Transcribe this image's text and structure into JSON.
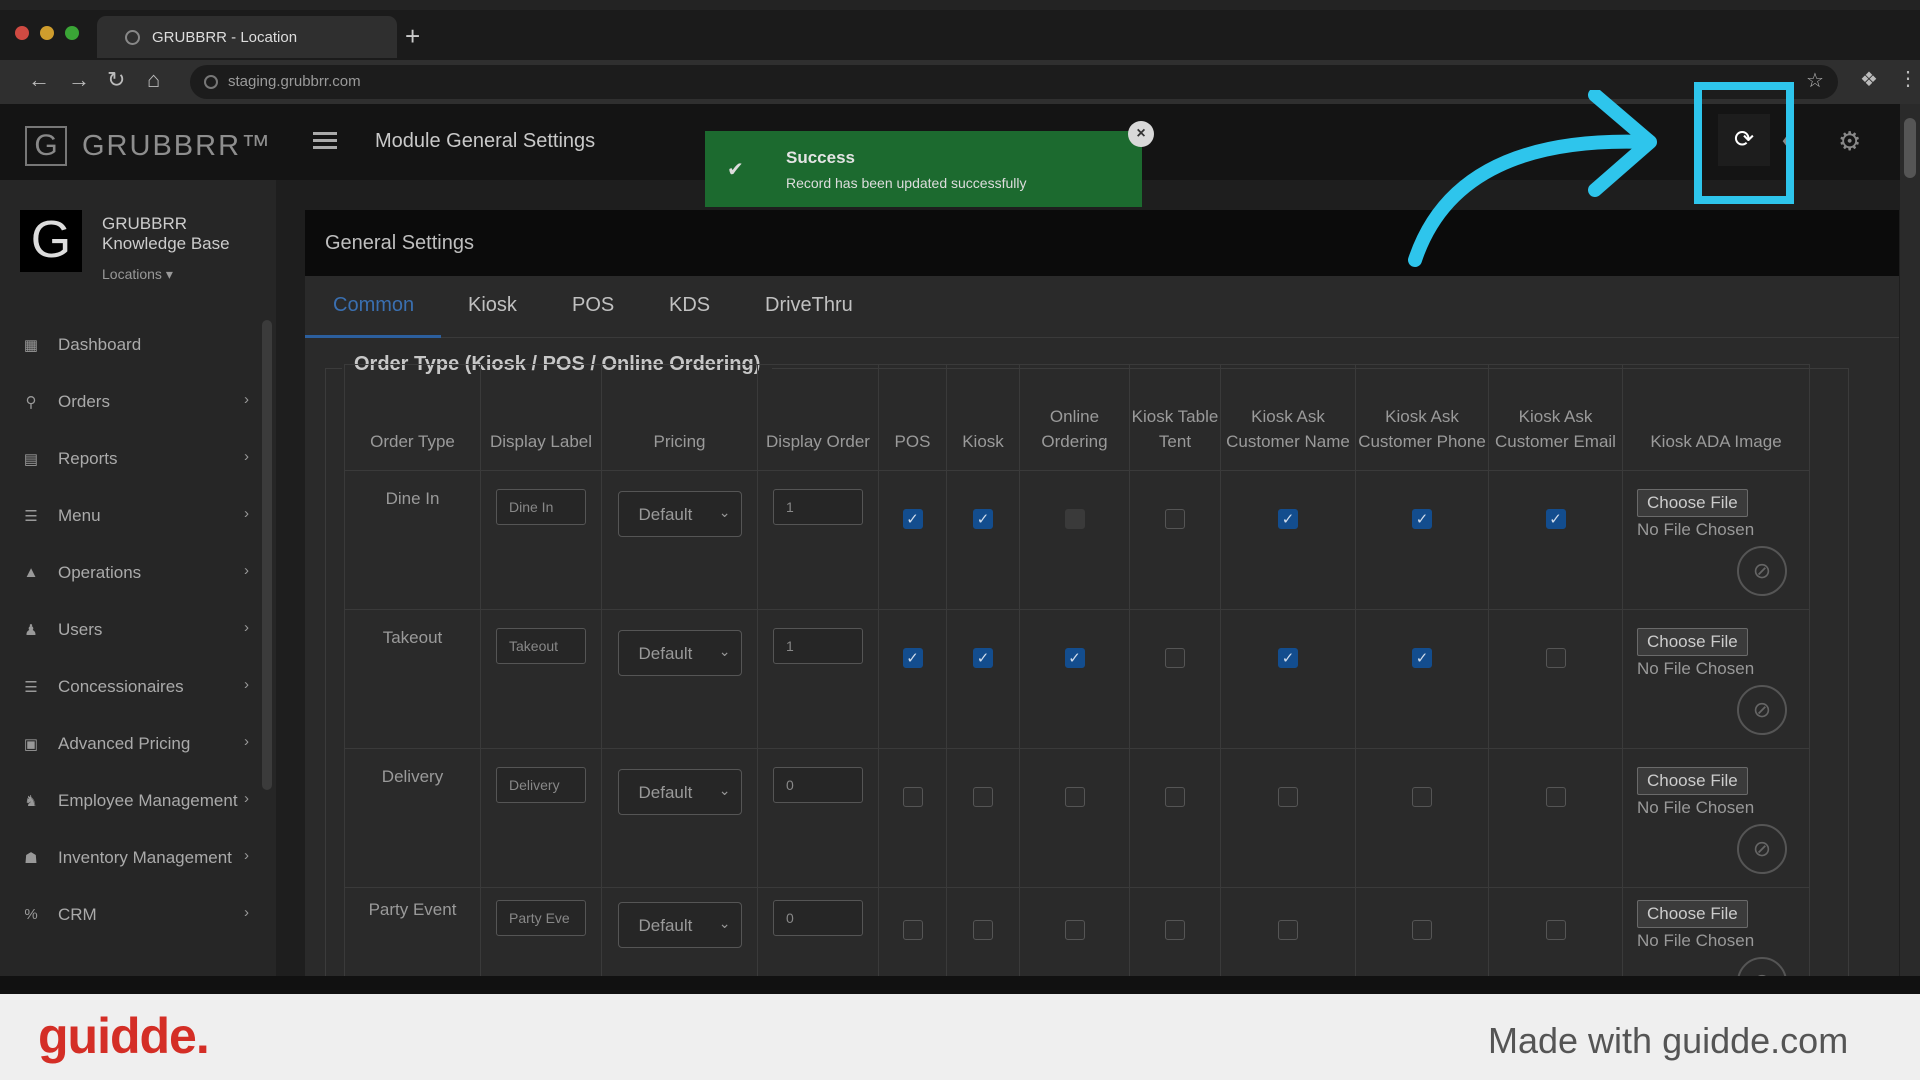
{
  "browser": {
    "tab_title": "GRUBBRR - Location",
    "url": "staging.grubbrr.com",
    "new_tab": "+"
  },
  "header": {
    "logo_letter": "G",
    "logo_text": "GRUBBRR™",
    "page_title": "Module General Settings"
  },
  "sidebar": {
    "avatar_letter": "G",
    "org_name": "GRUBBRR Knowledge Base",
    "locations_label": "Locations ▾",
    "items": [
      {
        "label": "Dashboard",
        "icon": "dashboard-icon",
        "chevron": ""
      },
      {
        "label": "Orders",
        "icon": "cart-icon",
        "chevron": "›"
      },
      {
        "label": "Reports",
        "icon": "report-icon",
        "chevron": "›"
      },
      {
        "label": "Menu",
        "icon": "menu-list-icon",
        "chevron": "›"
      },
      {
        "label": "Operations",
        "icon": "flask-icon",
        "chevron": "›"
      },
      {
        "label": "Users",
        "icon": "user-add-icon",
        "chevron": "›"
      },
      {
        "label": "Concessionaires",
        "icon": "list-icon",
        "chevron": "›"
      },
      {
        "label": "Advanced Pricing",
        "icon": "money-icon",
        "chevron": "›"
      },
      {
        "label": "Employee Management",
        "icon": "group-icon",
        "chevron": "›"
      },
      {
        "label": "Inventory Management",
        "icon": "sitemap-icon",
        "chevron": "›"
      },
      {
        "label": "CRM",
        "icon": "percent-icon",
        "chevron": "›"
      }
    ]
  },
  "toast": {
    "title": "Success",
    "message": "Record has been updated successfully"
  },
  "card": {
    "title": "General Settings",
    "tabs": [
      "Common",
      "Kiosk",
      "POS",
      "KDS",
      "DriveThru"
    ],
    "active_tab": "Common",
    "legend": "Order Type (Kiosk / POS / Online Ordering)"
  },
  "table": {
    "headers": [
      "Order Type",
      "Display Label",
      "Pricing",
      "Display Order",
      "POS",
      "Kiosk",
      "Online Ordering",
      "Kiosk Table Tent",
      "Kiosk Ask Customer Name",
      "Kiosk Ask Customer Phone",
      "Kiosk Ask Customer Email",
      "Kiosk ADA Image"
    ],
    "choose_file_label": "Choose File",
    "no_file_label": "No File Chosen",
    "rows": [
      {
        "order_type": "Dine In",
        "display_label": "Dine In",
        "pricing": "Default",
        "display_order": "1",
        "checks": [
          "on",
          "on",
          "disabled",
          "off",
          "on",
          "on",
          "on"
        ]
      },
      {
        "order_type": "Takeout",
        "display_label": "Takeout",
        "pricing": "Default",
        "display_order": "1",
        "checks": [
          "on",
          "on",
          "on",
          "off",
          "on",
          "on",
          "off"
        ]
      },
      {
        "order_type": "Delivery",
        "display_label": "Delivery",
        "pricing": "Default",
        "display_order": "0",
        "checks": [
          "off",
          "off",
          "off",
          "off",
          "off",
          "off",
          "off"
        ]
      },
      {
        "order_type": "Party Event",
        "display_label": "Party Eve",
        "pricing": "Default",
        "display_order": "0",
        "checks": [
          "off",
          "off",
          "off",
          "off",
          "off",
          "off",
          "off"
        ]
      }
    ]
  },
  "footer": {
    "logo": "guidde.",
    "text": "Made with guidde.com"
  },
  "colors": {
    "highlight": "#2ec5ec",
    "toast": "#1c6a2f",
    "checkbox_on": "#134d8e",
    "brand_red": "#d42e26"
  }
}
